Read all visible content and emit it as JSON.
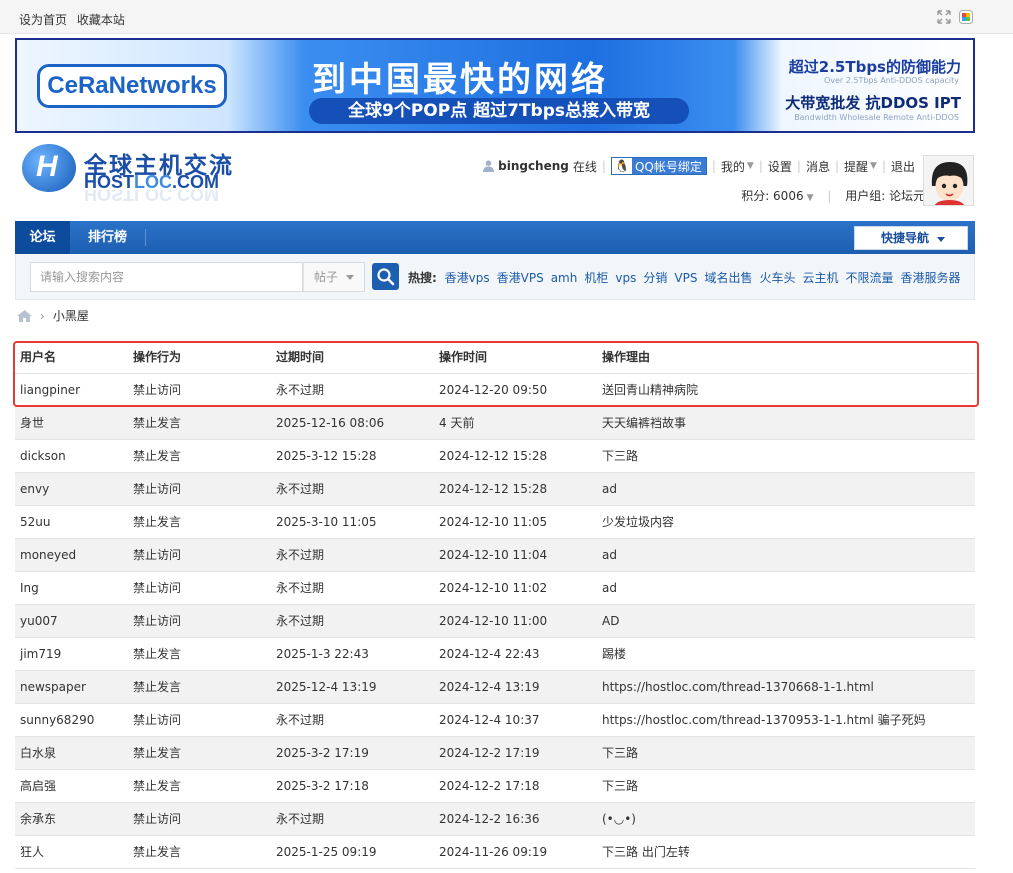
{
  "topbar": {
    "set_home": "设为首页",
    "bookmark": "收藏本站",
    "icons": [
      "fullscreen-icon",
      "style-switch-icon"
    ]
  },
  "banner": {
    "logo": "CeRaNetworks",
    "headline": "到中国最快的网络",
    "sub": "全球9个POP点 超过7Tbps总接入带宽",
    "right_line1": "超过2.5Tbps的防御能力",
    "right_line1_sub": "Over 2.5Tbps Anti-DDOS capacity",
    "right_line2": "大带宽批发 抗DDOS IPT",
    "right_line2_sub": "Bandwidth Wholesale Remote Anti-DDOS"
  },
  "site": {
    "logo_cn": "全球主机交流",
    "logo_en_a": "HOST",
    "logo_en_b": "LOC",
    "logo_en_c": ".COM"
  },
  "user": {
    "name": "bingcheng",
    "status": "在线",
    "qq_bind": "QQ帐号绑定",
    "menu": [
      "我的",
      "设置",
      "消息",
      "提醒",
      "退出"
    ],
    "credits": "积分: 6006",
    "group": "用户组: 论坛元老"
  },
  "nav": {
    "tabs": [
      "论坛",
      "排行榜"
    ],
    "quick_nav": "快捷导航"
  },
  "search": {
    "placeholder": "请输入搜索内容",
    "type": "帖子",
    "hot_label": "热搜:",
    "hot": [
      "香港vps",
      "香港VPS",
      "amh",
      "机柜",
      "vps",
      "分销",
      "VPS",
      "域名出售",
      "火车头",
      "云主机",
      "不限流量",
      "香港服务器"
    ]
  },
  "breadcrumb": {
    "current": "小黑屋"
  },
  "table": {
    "headers": [
      "用户名",
      "操作行为",
      "过期时间",
      "操作时间",
      "操作理由"
    ],
    "rows": [
      [
        "liangpiner",
        "禁止访问",
        "永不过期",
        "2024-12-20 09:50",
        "送回青山精神病院"
      ],
      [
        "身世",
        "禁止发言",
        "2025-12-16 08:06",
        "4 天前",
        "天天编裤裆故事"
      ],
      [
        "dickson",
        "禁止发言",
        "2025-3-12 15:28",
        "2024-12-12 15:28",
        "下三路"
      ],
      [
        "envy",
        "禁止访问",
        "永不过期",
        "2024-12-12 15:28",
        "ad"
      ],
      [
        "52uu",
        "禁止发言",
        "2025-3-10 11:05",
        "2024-12-10 11:05",
        "少发垃圾内容"
      ],
      [
        "moneyed",
        "禁止访问",
        "永不过期",
        "2024-12-10 11:04",
        "ad"
      ],
      [
        "Ing",
        "禁止访问",
        "永不过期",
        "2024-12-10 11:02",
        "ad"
      ],
      [
        "yu007",
        "禁止访问",
        "永不过期",
        "2024-12-10 11:00",
        "AD"
      ],
      [
        "jim719",
        "禁止发言",
        "2025-1-3 22:43",
        "2024-12-4 22:43",
        "踢楼"
      ],
      [
        "newspaper",
        "禁止发言",
        "2025-12-4 13:19",
        "2024-12-4 13:19",
        "https://hostloc.com/thread-1370668-1-1.html"
      ],
      [
        "sunny68290",
        "禁止访问",
        "永不过期",
        "2024-12-4 10:37",
        "https://hostloc.com/thread-1370953-1-1.html 骗子死妈"
      ],
      [
        "白水泉",
        "禁止发言",
        "2025-3-2 17:19",
        "2024-12-2 17:19",
        "下三路"
      ],
      [
        "高启强",
        "禁止发言",
        "2025-3-2 17:18",
        "2024-12-2 17:18",
        "下三路"
      ],
      [
        "余承东",
        "禁止访问",
        "永不过期",
        "2024-12-2 16:36",
        "(•◡•)"
      ],
      [
        "狂人",
        "禁止发言",
        "2025-1-25 09:19",
        "2024-11-26 09:19",
        "下三路 出门左转"
      ]
    ]
  },
  "colors": {
    "nav_blue": "#1d5eb0",
    "link_blue": "#1b5aa8",
    "highlight_red": "#e83a33"
  }
}
